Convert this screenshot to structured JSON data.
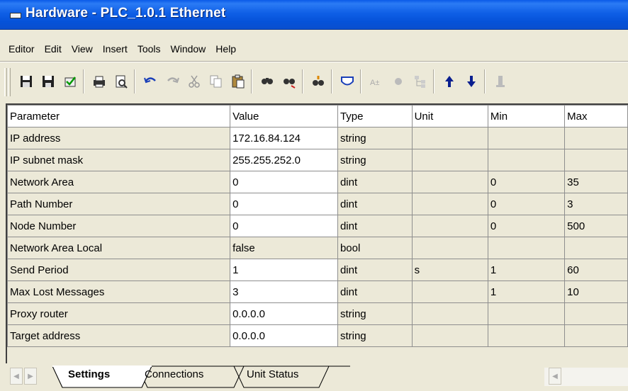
{
  "window": {
    "title": "Hardware - PLC_1.0.1  Ethernet"
  },
  "menu": [
    "Editor",
    "Edit",
    "View",
    "Insert",
    "Tools",
    "Window",
    "Help"
  ],
  "toolbar": [
    {
      "name": "save-icon",
      "group": 0
    },
    {
      "name": "save-all-icon",
      "group": 0
    },
    {
      "name": "check-icon",
      "group": 0
    },
    {
      "name": "print-icon",
      "group": 1
    },
    {
      "name": "print-preview-icon",
      "group": 1
    },
    {
      "name": "undo-icon",
      "group": 2
    },
    {
      "name": "redo-icon",
      "group": 2
    },
    {
      "name": "cut-icon",
      "group": 2
    },
    {
      "name": "copy-icon",
      "group": 2
    },
    {
      "name": "paste-icon",
      "group": 2
    },
    {
      "name": "find-icon",
      "group": 3
    },
    {
      "name": "find-replace-icon",
      "group": 3
    },
    {
      "name": "find-next-icon",
      "group": 4
    },
    {
      "name": "shield-icon",
      "group": 5
    },
    {
      "name": "text-icon",
      "group": 6
    },
    {
      "name": "dot-icon",
      "group": 6
    },
    {
      "name": "tree-icon",
      "group": 6
    },
    {
      "name": "move-up-icon",
      "group": 7
    },
    {
      "name": "move-down-icon",
      "group": 7
    },
    {
      "name": "pin-icon",
      "group": 8
    }
  ],
  "grid": {
    "columns": [
      "Parameter",
      "Value",
      "Type",
      "Unit",
      "Min",
      "Max"
    ],
    "rows": [
      [
        "IP address",
        "172.16.84.124",
        "string",
        "",
        "",
        ""
      ],
      [
        "IP subnet mask",
        "255.255.252.0",
        "string",
        "",
        "",
        ""
      ],
      [
        "Network Area",
        "0",
        "dint",
        "",
        "0",
        "35"
      ],
      [
        "Path Number",
        "0",
        "dint",
        "",
        "0",
        "3"
      ],
      [
        "Node Number",
        "0",
        "dint",
        "",
        "0",
        "500"
      ],
      [
        "Network Area Local",
        "false",
        "bool",
        "",
        "",
        ""
      ],
      [
        "Send Period",
        "1",
        "dint",
        "s",
        "1",
        "60"
      ],
      [
        "Max Lost Messages",
        "3",
        "dint",
        "",
        "1",
        "10"
      ],
      [
        "Proxy router",
        "0.0.0.0",
        "string",
        "",
        "",
        ""
      ],
      [
        "Target address",
        "0.0.0.0",
        "string",
        "",
        "",
        ""
      ]
    ],
    "editable_value_rows": [
      0,
      1,
      2,
      3,
      4,
      6,
      7,
      8,
      9
    ]
  },
  "tabs": [
    {
      "label": "Settings",
      "active": true
    },
    {
      "label": "Connections",
      "active": false
    },
    {
      "label": "Unit Status",
      "active": false
    }
  ]
}
